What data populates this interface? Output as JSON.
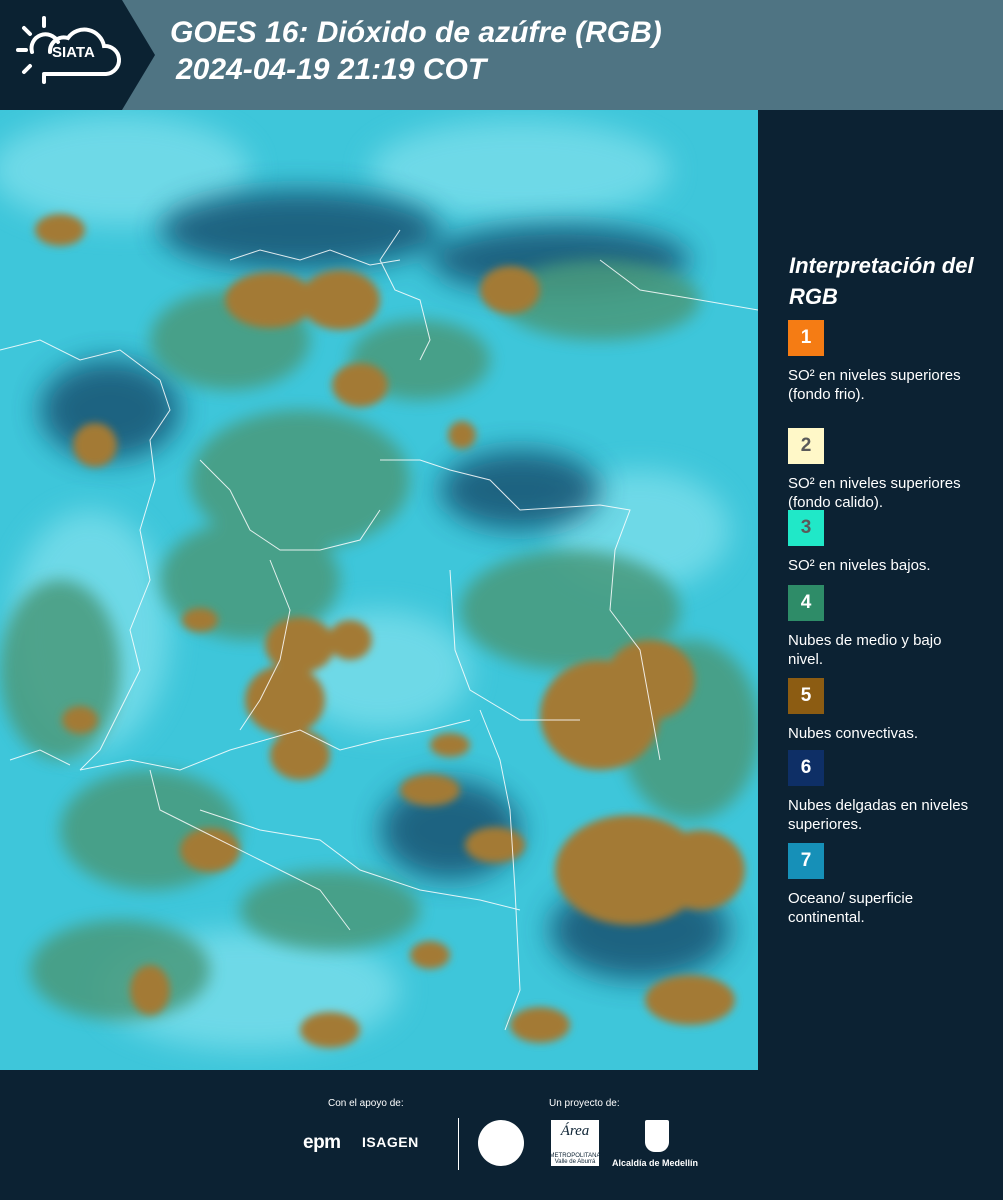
{
  "header": {
    "logo_text": "SIATA",
    "title_line1": "GOES 16: Dióxido de azúfre (RGB)",
    "title_line2": "2024-04-19 21:19 COT"
  },
  "legend": {
    "title": "Interpretación del RGB",
    "items": [
      {
        "number": "1",
        "color": "#f57c14",
        "text_color": "#ffffff",
        "description": "SO² en niveles superiores (fondo frio)."
      },
      {
        "number": "2",
        "color": "#fff8c8",
        "text_color": "#5a5a5a",
        "description": "SO² en niveles superiores (fondo calido)."
      },
      {
        "number": "3",
        "color": "#20e8c8",
        "text_color": "#5a5a5a",
        "description": "SO² en niveles bajos."
      },
      {
        "number": "4",
        "color": "#2e8c68",
        "text_color": "#ffffff",
        "description": "Nubes de medio y bajo nivel."
      },
      {
        "number": "5",
        "color": "#8c5c12",
        "text_color": "#ffffff",
        "description": "Nubes convectivas."
      },
      {
        "number": "6",
        "color": "#0e2f66",
        "text_color": "#ffffff",
        "description": "Nubes delgadas en niveles superiores."
      },
      {
        "number": "7",
        "color": "#1690b8",
        "text_color": "#ffffff",
        "description": "Oceano/ superficie continental."
      }
    ]
  },
  "footer": {
    "support_label": "Con el apoyo de:",
    "project_label": "Un proyecto de:",
    "support_logos": [
      "epm",
      "ISAGEN"
    ],
    "project_logos": {
      "area_name": "Área",
      "area_sub": "METROPOLITANA Valle de Aburrá",
      "alcaldia": "Alcaldía de Medellín"
    }
  },
  "colors": {
    "background": "#0c2233",
    "header_band": "#4f7483",
    "map_cyan": "#3ac4d8",
    "map_green": "#4a9a7c",
    "map_convective": "#a37a36",
    "map_dark": "#134c6c",
    "borders": "#ffffff"
  },
  "icons": [
    "sun-icon",
    "cloud-icon"
  ]
}
